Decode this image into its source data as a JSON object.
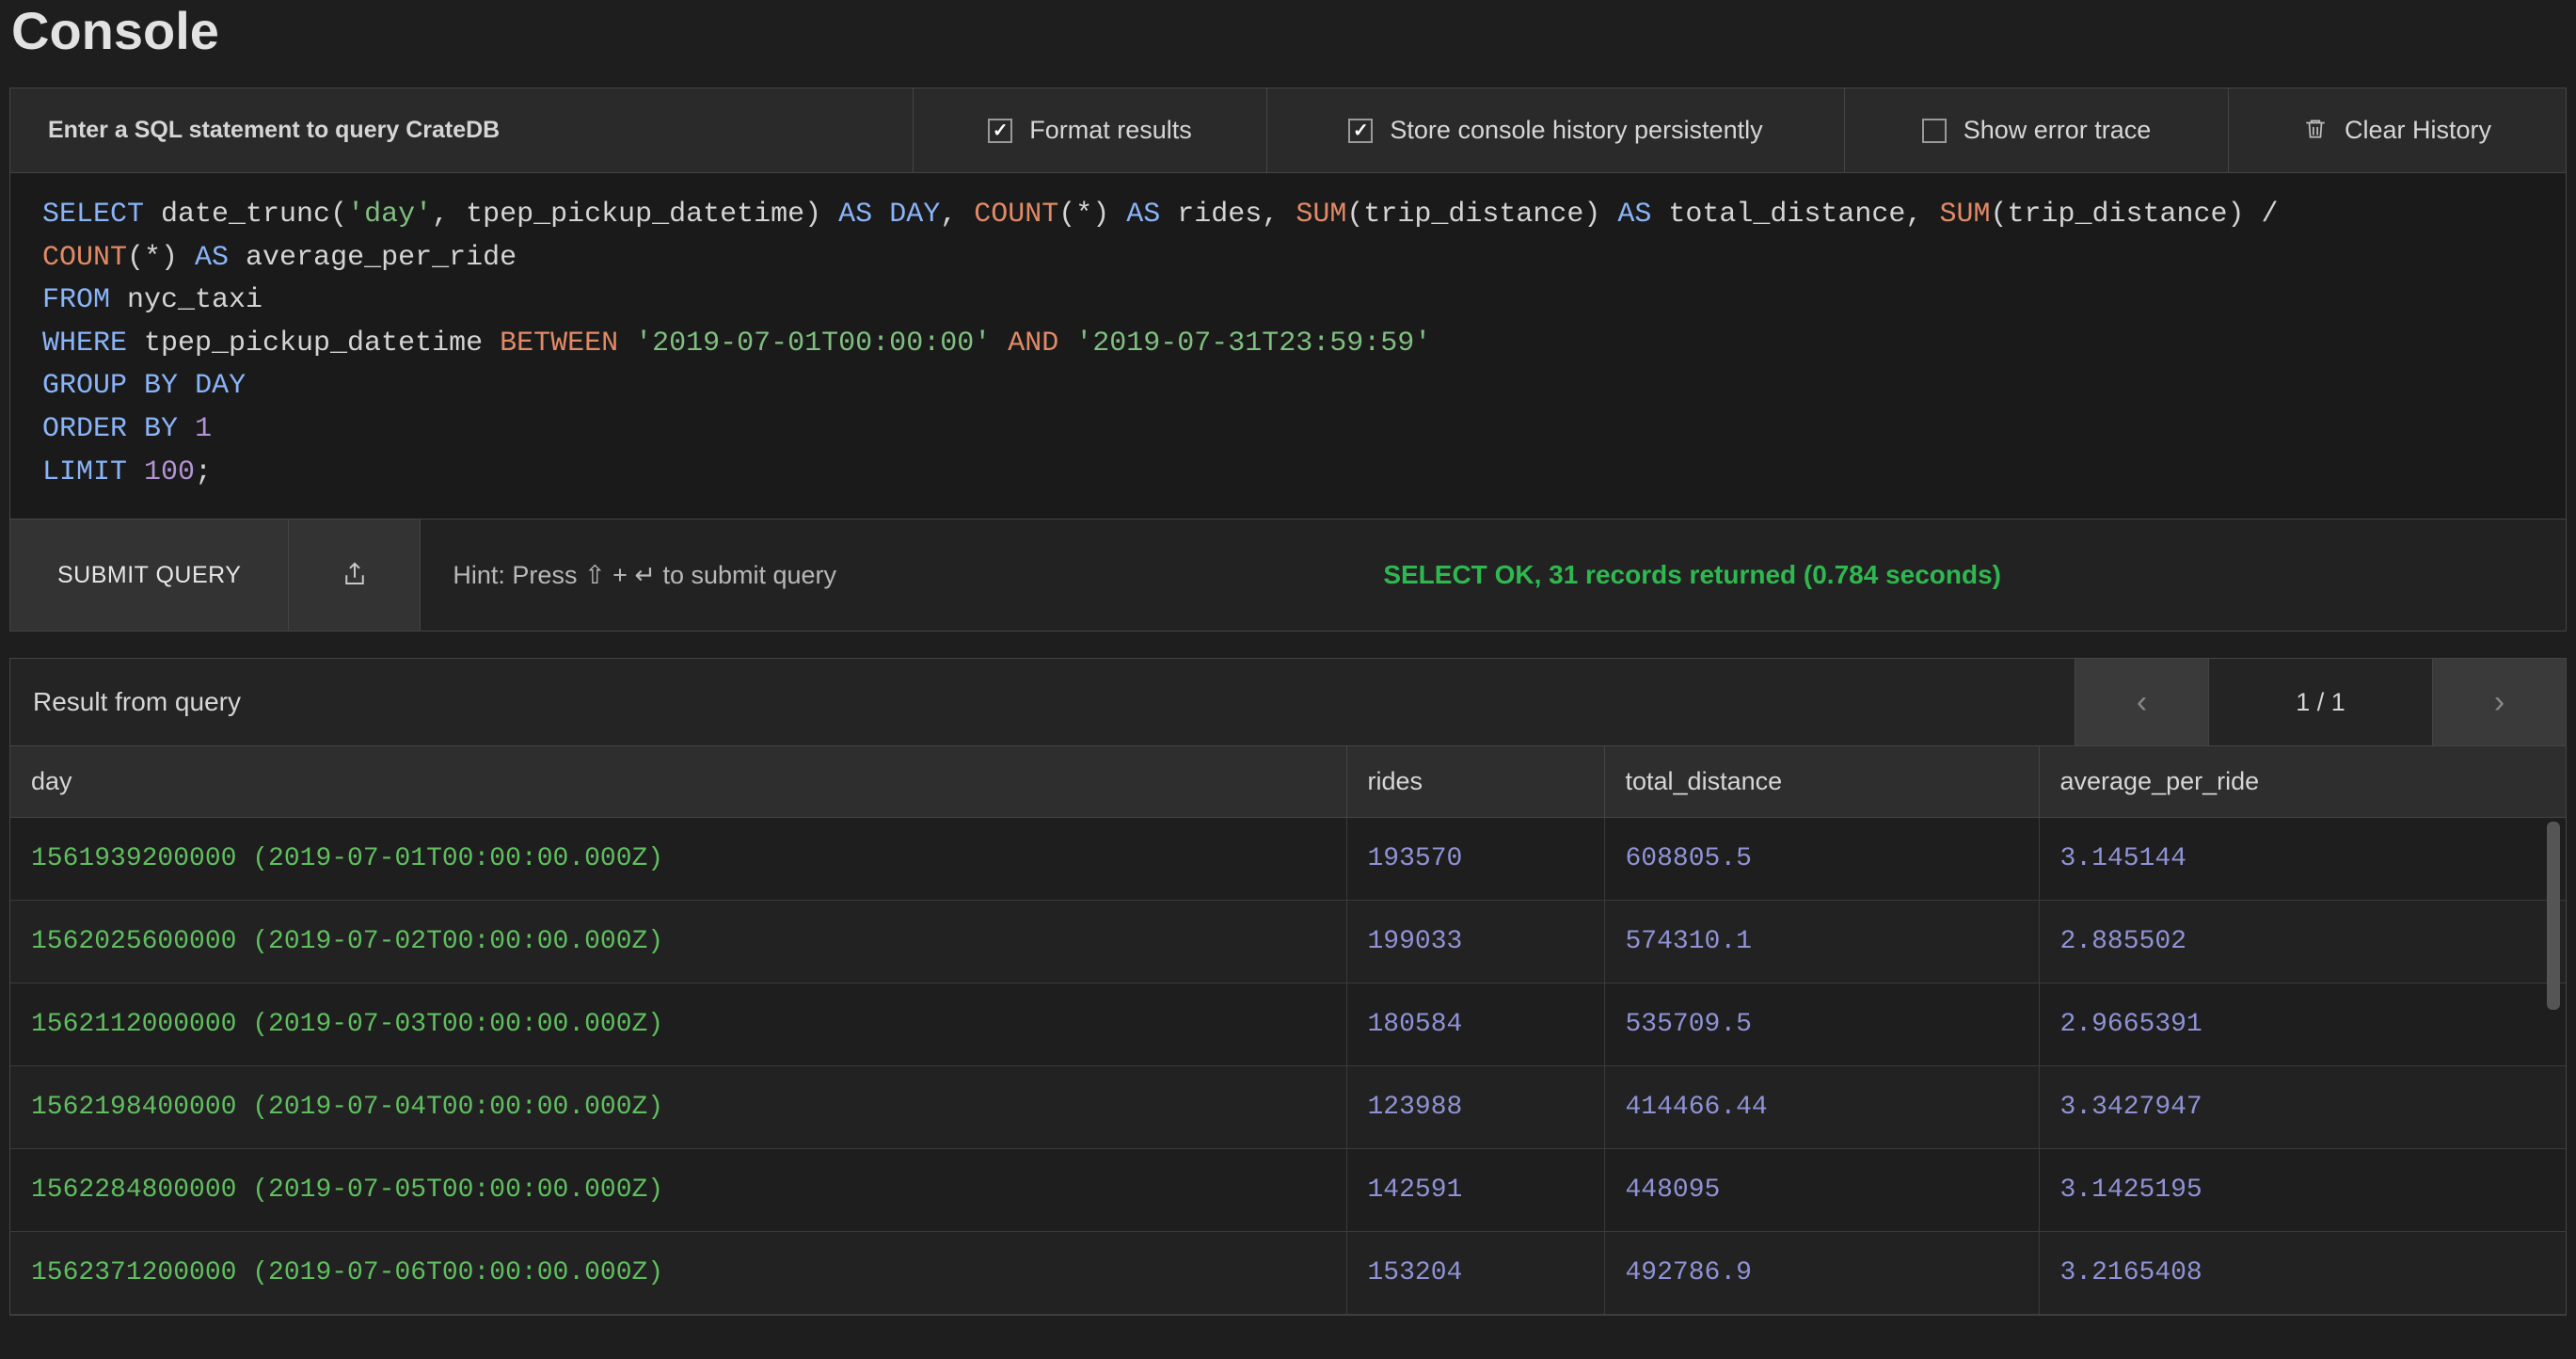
{
  "title": "Console",
  "toolbar": {
    "prompt": "Enter a SQL statement to query CrateDB",
    "format_label": "Format results",
    "format_checked": true,
    "persist_label": "Store console history persistently",
    "persist_checked": true,
    "error_label": "Show error trace",
    "error_checked": false,
    "clear_label": "Clear History"
  },
  "query": {
    "tokens": [
      {
        "t": "SELECT",
        "c": "kw"
      },
      {
        "t": " date_trunc(",
        "c": "ident"
      },
      {
        "t": "'day'",
        "c": "str"
      },
      {
        "t": ", tpep_pickup_datetime) ",
        "c": "ident"
      },
      {
        "t": "AS",
        "c": "kw"
      },
      {
        "t": " ",
        "c": "ident"
      },
      {
        "t": "DAY",
        "c": "kw"
      },
      {
        "t": ", ",
        "c": "ident"
      },
      {
        "t": "COUNT",
        "c": "fn"
      },
      {
        "t": "(*) ",
        "c": "ident"
      },
      {
        "t": "AS",
        "c": "kw"
      },
      {
        "t": " rides, ",
        "c": "ident"
      },
      {
        "t": "SUM",
        "c": "fn"
      },
      {
        "t": "(trip_distance) ",
        "c": "ident"
      },
      {
        "t": "AS",
        "c": "kw"
      },
      {
        "t": " total_distance, ",
        "c": "ident"
      },
      {
        "t": "SUM",
        "c": "fn"
      },
      {
        "t": "(trip_distance) / ",
        "c": "ident"
      },
      {
        "t": "\n",
        "c": ""
      },
      {
        "t": "COUNT",
        "c": "fn"
      },
      {
        "t": "(*) ",
        "c": "ident"
      },
      {
        "t": "AS",
        "c": "kw"
      },
      {
        "t": " average_per_ride",
        "c": "ident"
      },
      {
        "t": "\n",
        "c": ""
      },
      {
        "t": "FROM",
        "c": "kw"
      },
      {
        "t": " nyc_taxi",
        "c": "ident"
      },
      {
        "t": "\n",
        "c": ""
      },
      {
        "t": "WHERE",
        "c": "kw"
      },
      {
        "t": " tpep_pickup_datetime ",
        "c": "ident"
      },
      {
        "t": "BETWEEN",
        "c": "fn"
      },
      {
        "t": " ",
        "c": "ident"
      },
      {
        "t": "'2019-07-01T00:00:00'",
        "c": "str"
      },
      {
        "t": " ",
        "c": "ident"
      },
      {
        "t": "AND",
        "c": "fn"
      },
      {
        "t": " ",
        "c": "ident"
      },
      {
        "t": "'2019-07-31T23:59:59'",
        "c": "str"
      },
      {
        "t": "\n",
        "c": ""
      },
      {
        "t": "GROUP",
        "c": "kw"
      },
      {
        "t": " ",
        "c": "ident"
      },
      {
        "t": "BY",
        "c": "kw"
      },
      {
        "t": " ",
        "c": "ident"
      },
      {
        "t": "DAY",
        "c": "kw"
      },
      {
        "t": "\n",
        "c": ""
      },
      {
        "t": "ORDER",
        "c": "kw"
      },
      {
        "t": " ",
        "c": "ident"
      },
      {
        "t": "BY",
        "c": "kw"
      },
      {
        "t": " ",
        "c": "ident"
      },
      {
        "t": "1",
        "c": "num"
      },
      {
        "t": "\n",
        "c": ""
      },
      {
        "t": "LIMIT",
        "c": "kw"
      },
      {
        "t": " ",
        "c": "ident"
      },
      {
        "t": "100",
        "c": "num"
      },
      {
        "t": ";",
        "c": "ident"
      }
    ]
  },
  "actions": {
    "submit_label": "SUBMIT QUERY",
    "hint": "Hint: Press ⇧ + ↵ to submit query",
    "status": "SELECT OK, 31 records returned (0.784 seconds)"
  },
  "results": {
    "title": "Result from query",
    "page_label": "1 / 1",
    "columns": [
      "day",
      "rides",
      "total_distance",
      "average_per_ride"
    ],
    "rows": [
      [
        "1561939200000 (2019-07-01T00:00:00.000Z)",
        "193570",
        "608805.5",
        "3.145144"
      ],
      [
        "1562025600000 (2019-07-02T00:00:00.000Z)",
        "199033",
        "574310.1",
        "2.885502"
      ],
      [
        "1562112000000 (2019-07-03T00:00:00.000Z)",
        "180584",
        "535709.5",
        "2.9665391"
      ],
      [
        "1562198400000 (2019-07-04T00:00:00.000Z)",
        "123988",
        "414466.44",
        "3.3427947"
      ],
      [
        "1562284800000 (2019-07-05T00:00:00.000Z)",
        "142591",
        "448095",
        "3.1425195"
      ],
      [
        "1562371200000 (2019-07-06T00:00:00.000Z)",
        "153204",
        "492786.9",
        "3.2165408"
      ]
    ]
  }
}
